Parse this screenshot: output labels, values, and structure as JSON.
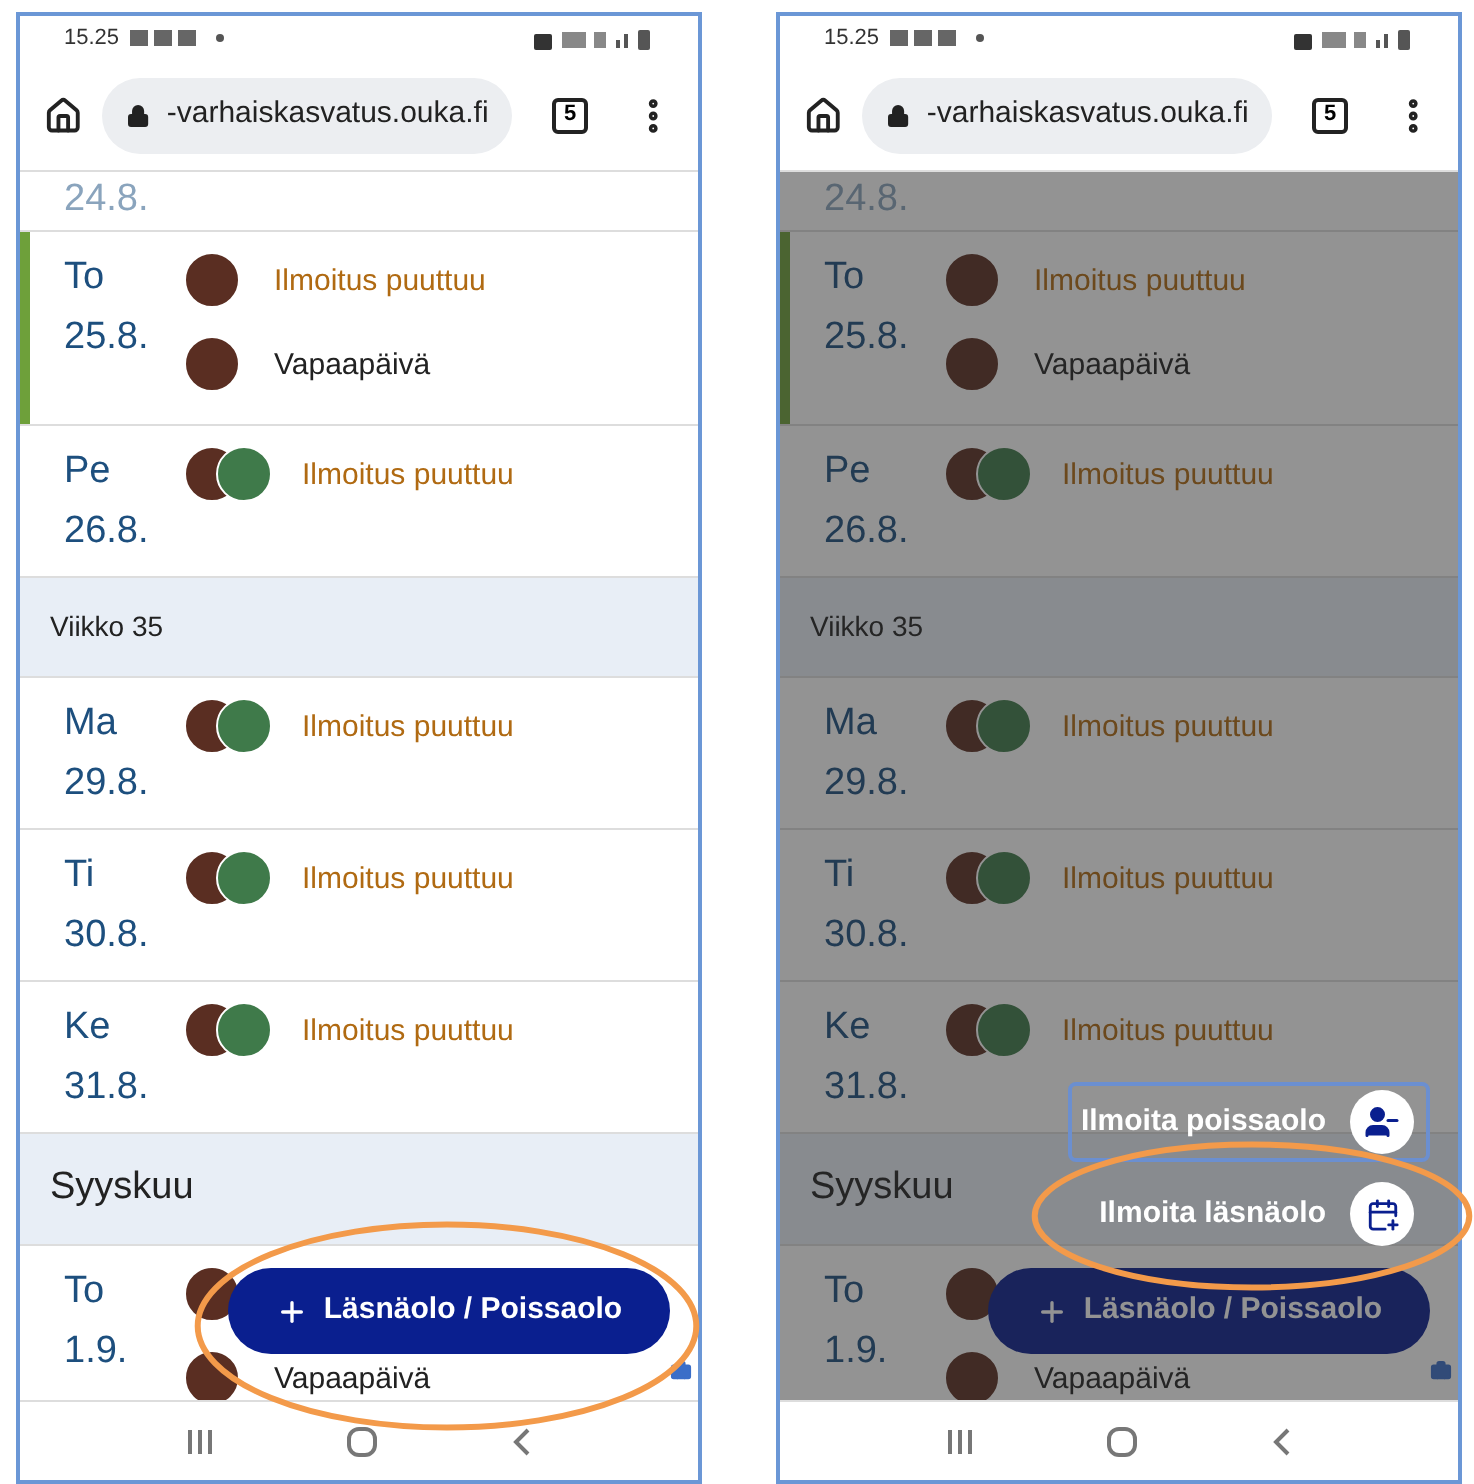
{
  "screens": [
    {
      "status_time": "15.25",
      "url": "-varhaiskasvatus.ouka.fi",
      "tab_count": "5",
      "menu_open": false,
      "items": [
        {
          "kind": "partial",
          "date": "24.8."
        },
        {
          "kind": "day",
          "day": "To",
          "date": "25.8.",
          "today": true,
          "entries": [
            {
              "kind": "single",
              "missing": true,
              "status": "Ilmoitus puuttuu"
            },
            {
              "kind": "single",
              "missing": false,
              "status": "Vapaapäivä"
            }
          ]
        },
        {
          "kind": "day",
          "day": "Pe",
          "date": "26.8.",
          "today": false,
          "entries": [
            {
              "kind": "pair",
              "missing": true,
              "status": "Ilmoitus puuttuu"
            }
          ]
        },
        {
          "kind": "week",
          "label": "Viikko 35"
        },
        {
          "kind": "day",
          "day": "Ma",
          "date": "29.8.",
          "today": false,
          "entries": [
            {
              "kind": "pair",
              "missing": true,
              "status": "Ilmoitus puuttuu"
            }
          ]
        },
        {
          "kind": "day",
          "day": "Ti",
          "date": "30.8.",
          "today": false,
          "entries": [
            {
              "kind": "pair",
              "missing": true,
              "status": "Ilmoitus puuttuu"
            }
          ]
        },
        {
          "kind": "day",
          "day": "Ke",
          "date": "31.8.",
          "today": false,
          "entries": [
            {
              "kind": "pair",
              "missing": true,
              "status": "Ilmoitus puuttuu"
            }
          ]
        },
        {
          "kind": "month",
          "label": "Syyskuu"
        },
        {
          "kind": "day",
          "day": "To",
          "date": "1.9.",
          "today": false,
          "entries": [
            {
              "kind": "single"
            },
            {
              "kind": "single",
              "missing": false,
              "status": "Vapaapäivä"
            }
          ]
        }
      ],
      "fab": {
        "label": "Läsnäolo / Poissaolo",
        "highlighted": true
      }
    },
    {
      "status_time": "15.25",
      "url": "-varhaiskasvatus.ouka.fi",
      "tab_count": "5",
      "menu_open": true,
      "items": [
        {
          "kind": "partial",
          "date": "24.8."
        },
        {
          "kind": "day",
          "day": "To",
          "date": "25.8.",
          "today": true,
          "entries": [
            {
              "kind": "single",
              "missing": true,
              "status": "Ilmoitus puuttuu"
            },
            {
              "kind": "single",
              "missing": false,
              "status": "Vapaapäivä"
            }
          ]
        },
        {
          "kind": "day",
          "day": "Pe",
          "date": "26.8.",
          "today": false,
          "entries": [
            {
              "kind": "pair",
              "missing": true,
              "status": "Ilmoitus puuttuu"
            }
          ]
        },
        {
          "kind": "week",
          "label": "Viikko 35"
        },
        {
          "kind": "day",
          "day": "Ma",
          "date": "29.8.",
          "today": false,
          "entries": [
            {
              "kind": "pair",
              "missing": true,
              "status": "Ilmoitus puuttuu"
            }
          ]
        },
        {
          "kind": "day",
          "day": "Ti",
          "date": "30.8.",
          "today": false,
          "entries": [
            {
              "kind": "pair",
              "missing": true,
              "status": "Ilmoitus puuttuu"
            }
          ]
        },
        {
          "kind": "day",
          "day": "Ke",
          "date": "31.8.",
          "today": false,
          "entries": [
            {
              "kind": "pair",
              "missing": true,
              "status": "Ilmoitus puuttuu"
            }
          ]
        },
        {
          "kind": "month",
          "label": "Syyskuu"
        },
        {
          "kind": "day",
          "day": "To",
          "date": "1.9.",
          "today": false,
          "entries": [
            {
              "kind": "single"
            },
            {
              "kind": "single",
              "missing": false,
              "status": "Vapaapäivä"
            }
          ]
        }
      ],
      "fab": {
        "label": "Läsnäolo / Poissaolo",
        "highlighted": false
      },
      "menu_options": [
        {
          "kind": "absence",
          "label": "Ilmoita poissaolo",
          "focused": true,
          "highlighted": false
        },
        {
          "kind": "presence",
          "label": "Ilmoita läsnäolo",
          "focused": false,
          "highlighted": true
        }
      ]
    }
  ]
}
